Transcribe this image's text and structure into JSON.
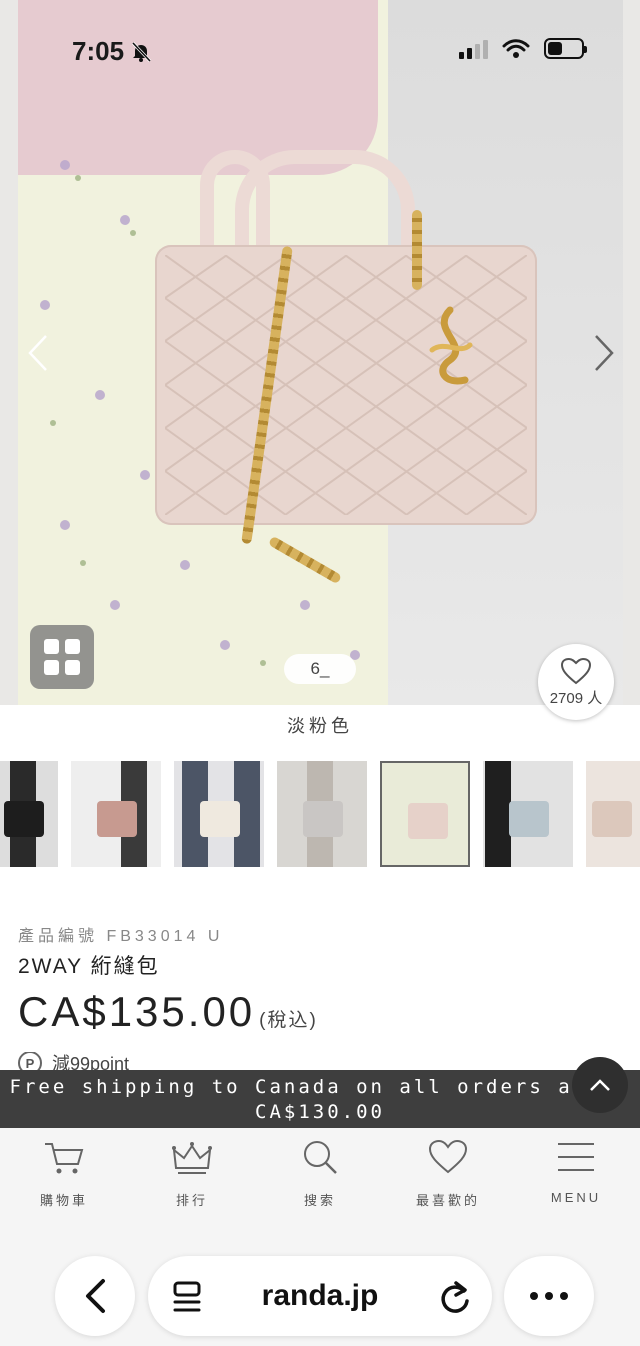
{
  "status_bar": {
    "time": "7:05"
  },
  "gallery": {
    "counter": "6_",
    "favorite_count": "2709 人",
    "color_name": "淡粉色"
  },
  "product": {
    "code": "產品編號 FB33014 U",
    "name": "2WAY 絎縫包",
    "price": "CA$135.00",
    "tax_note": "(稅込)",
    "points_icon": "P",
    "points": "減99point"
  },
  "shipping_banner": {
    "text": "Free shipping to Canada on all orders above CA$130.00"
  },
  "bottom_nav": {
    "items": [
      {
        "label": "購物車",
        "icon": "cart-icon"
      },
      {
        "label": "排行",
        "icon": "crown-icon"
      },
      {
        "label": "搜索",
        "icon": "search-icon"
      },
      {
        "label": "最喜歡的",
        "icon": "heart-icon"
      },
      {
        "label": "MENU",
        "icon": "menu-icon"
      }
    ]
  },
  "browser": {
    "url": "randa.jp"
  },
  "colors": {
    "banner_bg": "#3e3e3e",
    "nav_bg": "#f5f5f5",
    "bag_pink": "#e8d6cf",
    "gold": "#d7b25e"
  }
}
